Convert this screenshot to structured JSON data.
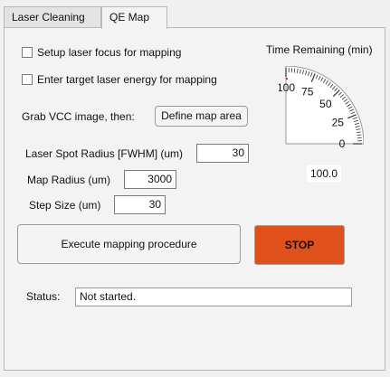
{
  "tabs": [
    {
      "label": "Laser Cleaning",
      "active": false
    },
    {
      "label": "QE Map",
      "active": true
    }
  ],
  "mapping": {
    "setup_focus_label": "Setup laser focus for mapping",
    "setup_focus_checked": false,
    "target_energy_label": "Enter target laser energy for mapping",
    "target_energy_checked": false,
    "grab_vcc_label": "Grab VCC image, then:",
    "define_map_button": "Define map area",
    "spot_radius_label": "Laser Spot Radius [FWHM] (um)",
    "spot_radius_value": "30",
    "map_radius_label": "Map Radius (um)",
    "map_radius_value": "3000",
    "step_size_label": "Step Size (um)",
    "step_size_value": "30",
    "execute_button": "Execute mapping procedure",
    "stop_button": "STOP",
    "stop_color": "#e0501a"
  },
  "gauge": {
    "title": "Time Remaining (min)",
    "min": 0,
    "max": 100,
    "value": 100,
    "tick_labels": [
      "0",
      "25",
      "50",
      "75",
      "100"
    ],
    "readout": "100.0",
    "needle_color": "#d03030"
  },
  "status": {
    "label": "Status:",
    "value": "Not started."
  }
}
